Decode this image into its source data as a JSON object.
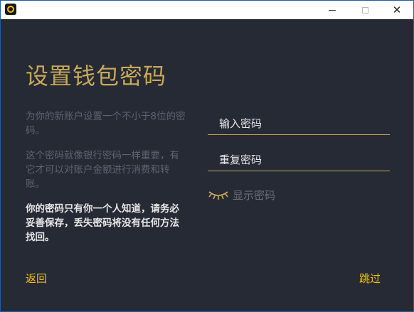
{
  "window": {
    "minimize_label": "",
    "maximize_label": "",
    "close_label": "✕"
  },
  "main": {
    "title": "设置钱包密码",
    "para1": "为你的新账户设置一个不小于8位的密码。",
    "para2": "这个密码就像银行密码一样重要，有它才可以对账户金额进行消费和转账。",
    "para_bold": "你的密码只有你一个人知道，请务必妥善保存，丢失密码将没有任何方法找回。"
  },
  "form": {
    "password_placeholder": "输入密码",
    "confirm_placeholder": "重复密码",
    "show_password_label": "显示密码",
    "show_password_icon": "closed-eye-icon"
  },
  "footer": {
    "back_label": "返回",
    "skip_label": "跳过"
  },
  "colors": {
    "background": "#262a35",
    "accent_gold": "#c8a958",
    "accent_yellow": "#f2c200",
    "muted_text": "#5e6370"
  }
}
